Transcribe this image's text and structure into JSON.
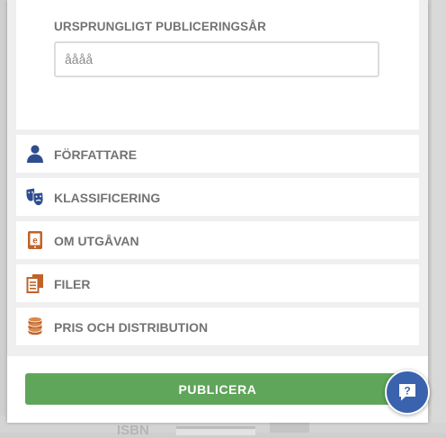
{
  "year_field": {
    "label": "URSPRUNGLIGT PUBLICERINGSÅR",
    "placeholder": "åååå",
    "value": ""
  },
  "sections": [
    {
      "label": "FÖRFATTARE",
      "icon": "person-icon",
      "color": "#2f4d8f"
    },
    {
      "label": "KLASSIFICERING",
      "icon": "theater-masks-icon",
      "color": "#2f4d8f"
    },
    {
      "label": "OM UTGÅVAN",
      "icon": "ebook-icon",
      "color": "#c0622a"
    },
    {
      "label": "FILER",
      "icon": "files-icon",
      "color": "#c0622a"
    },
    {
      "label": "PRIS OCH DISTRIBUTION",
      "icon": "coins-icon",
      "color": "#c0622a"
    }
  ],
  "footer": {
    "publish_label": "PUBLICERA"
  },
  "help": {
    "icon": "help-chat-icon"
  },
  "backdrop": {
    "isbn_label": "ISBN"
  },
  "colors": {
    "accent_green": "#5fa55a",
    "help_blue": "#3a62ad",
    "label_gray": "#737373"
  }
}
